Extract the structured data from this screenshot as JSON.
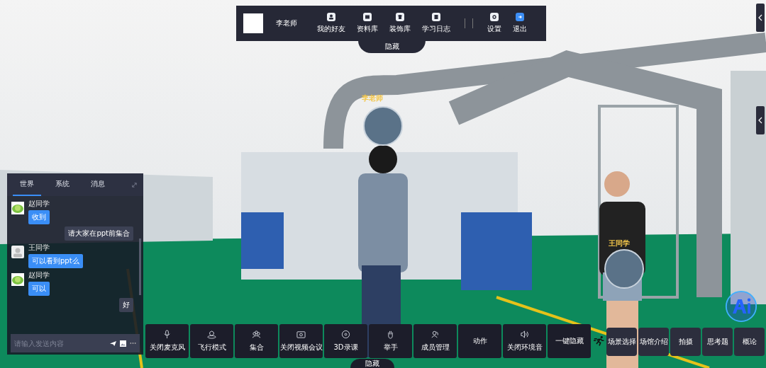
{
  "top_bar": {
    "user_name": "李老师",
    "items": [
      {
        "label": "我的好友",
        "kind": "person"
      },
      {
        "label": "资料库",
        "kind": "folder"
      },
      {
        "label": "装饰库",
        "kind": "shirt"
      },
      {
        "label": "学习日志",
        "kind": "book"
      },
      {
        "label": "设置",
        "kind": "gear"
      },
      {
        "label": "退出",
        "kind": "exit"
      }
    ],
    "hide_tab": "隐藏"
  },
  "scene_labels": [
    {
      "name": "李老师",
      "kind": "video"
    },
    {
      "name": "王同学",
      "kind": "video"
    }
  ],
  "chat": {
    "tabs": [
      {
        "label": "世界",
        "selected": true
      },
      {
        "label": "系统",
        "selected": false
      },
      {
        "label": "消息",
        "selected": false
      }
    ],
    "messages": [
      {
        "sender": "赵同学",
        "text": "收到",
        "kind": "lettuce"
      },
      {
        "text": "请大家在ppt前集合",
        "kind": "self"
      },
      {
        "sender": "王同学",
        "text": "可以看到ppt么",
        "kind": "person"
      },
      {
        "sender": "赵同学",
        "text": "可以",
        "kind": "lettuce"
      },
      {
        "text": "好",
        "kind": "self"
      }
    ],
    "input": {
      "placeholder": "请输入发送内容"
    }
  },
  "toolbar": {
    "buttons": [
      {
        "label": "关闭麦克风",
        "kind": "mic"
      },
      {
        "label": "飞行模式",
        "kind": "fly"
      },
      {
        "label": "集合",
        "kind": "group"
      },
      {
        "label": "关闭视频会议",
        "kind": "camera"
      },
      {
        "label": "3D录课",
        "kind": "record"
      },
      {
        "label": "举手",
        "kind": "hand"
      },
      {
        "label": "成员管理",
        "kind": "members"
      },
      {
        "label": "动作",
        "kind": "text"
      },
      {
        "label": "关闭环境音",
        "kind": "sound"
      },
      {
        "label": "一键隐藏",
        "kind": "text"
      }
    ],
    "hide_tab": "隐藏"
  },
  "side_buttons": [
    "场景选择",
    "场馆介绍",
    "拍摄",
    "思考题",
    "概论"
  ]
}
